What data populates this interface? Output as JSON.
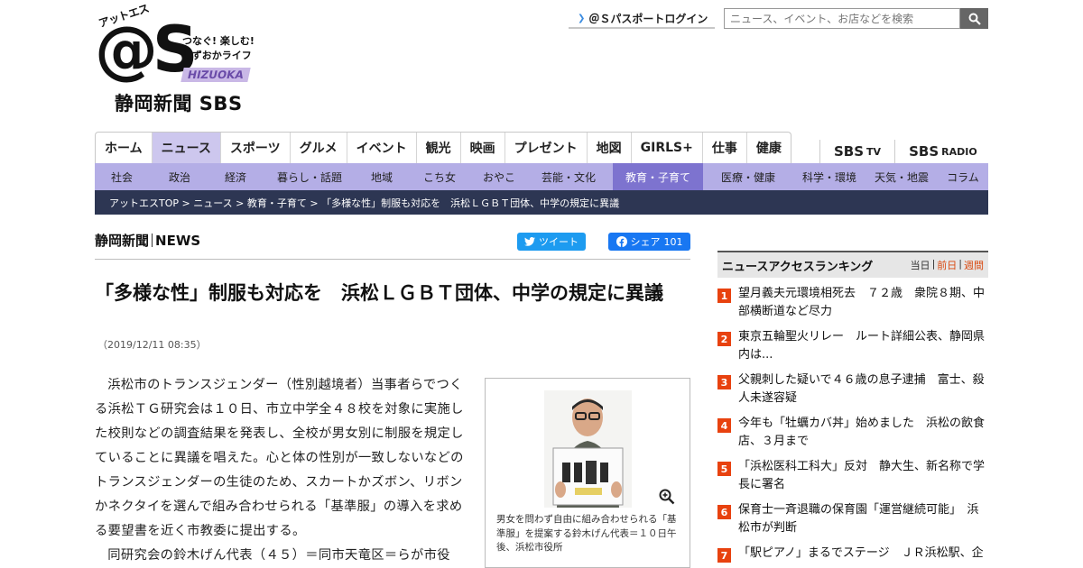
{
  "logo": {
    "kana": "アットエス",
    "mark": "@S",
    "tagline_1": "つなぐ! 楽しむ!",
    "tagline_2": "しずおかライフ",
    "pref": "HIZUOKA",
    "paper": "静岡新聞 SBS"
  },
  "header": {
    "passport_label": "＠Ｓパスポートログイン",
    "search_placeholder": "ニュース、イベント、お店などを検索"
  },
  "mainnav": [
    "ホーム",
    "ニュース",
    "スポーツ",
    "グルメ",
    "イベント",
    "観光",
    "映画",
    "プレゼント",
    "地図",
    "GIRLS+",
    "仕事",
    "健康"
  ],
  "mainnav_active": "ニュース",
  "sbs_links": [
    {
      "main": "SBS",
      "sub": "TV"
    },
    {
      "main": "SBS",
      "sub": "RADIO"
    }
  ],
  "subnav": [
    "社会",
    "政治",
    "経済",
    "暮らし・話題",
    "地域",
    "こち女",
    "おやこ",
    "芸能・文化",
    "教育・子育て",
    "医療・健康",
    "科学・環境",
    "天気・地震",
    "コラム"
  ],
  "subnav_active": "教育・子育て",
  "breadcrumb": "アットエスTOP > ニュース > 教育・子育て > 「多様な性」制服も対応を　浜松ＬＧＢＴ団体、中学の規定に異議",
  "source": {
    "left": "静岡新聞",
    "right": "NEWS"
  },
  "social": {
    "tweet": "ツイート",
    "share": "シェア",
    "share_count": "101"
  },
  "article": {
    "headline": "「多様な性」制服も対応を　浜松ＬＧＢＴ団体、中学の規定に異議",
    "date": "（2019/12/11 08:35）",
    "paragraphs": [
      "浜松市のトランスジェンダー（性別越境者）当事者らでつくる浜松ＴＧ研究会は１０日、市立中学全４８校を対象に実施した校則などの調査結果を発表し、全校が男女別に制服を規定していることに異議を唱えた。心と体の性別が一致しないなどのトランスジェンダーの生徒のため、スカートかズボン、リボンかネクタイを選んで組み合わせられる「基準服」の導入を求める要望書を近く市教委に提出する。",
      "同研究会の鈴木げん代表（４５）＝同市天竜区＝らが市役"
    ],
    "photo_caption": "男女を問わず自由に組み合わせられる「基準服」を提案する鈴木げん代表＝１０日午後、浜松市役所"
  },
  "ranking": {
    "title": "ニュースアクセスランキング",
    "tabs": [
      "当日",
      "前日",
      "週間"
    ],
    "items": [
      {
        "num": "1",
        "text": "望月義夫元環境相死去　７２歳　衆院８期、中部横断道など尽力"
      },
      {
        "num": "2",
        "text": "東京五輪聖火リレー　ルート詳細公表、静岡県内は..."
      },
      {
        "num": "3",
        "text": "父親刺した疑いで４６歳の息子逮捕　富士、殺人未遂容疑"
      },
      {
        "num": "4",
        "text": "今年も「牡蠣カバ丼」始めました　浜松の飲食店、３月まで"
      },
      {
        "num": "5",
        "text": "「浜松医科工科大」反対　静大生、新名称で学長に署名"
      },
      {
        "num": "6",
        "text": "保育士一斉退職の保育園「運営継続可能」　浜松市が判断"
      },
      {
        "num": "7",
        "text": "「駅ピアノ」まるでステージ　ＪＲ浜松駅、企"
      }
    ]
  },
  "colors": {
    "subnav": "#b4aee6",
    "subnav_active": "#7d73cf",
    "crumb_bg": "#2d3653",
    "rank_badge": "#e8420f"
  }
}
